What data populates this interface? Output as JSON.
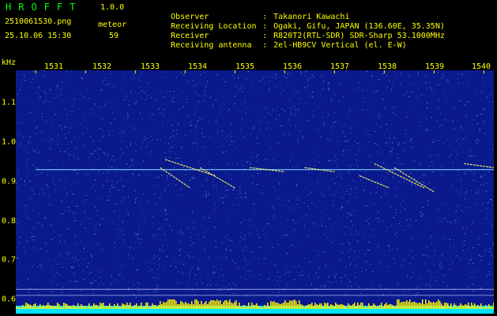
{
  "header": {
    "app_title": "HROFFT",
    "app_version": "1.0.0",
    "file_name": "2510061530.png",
    "date_time": "25.10.06 15:30",
    "meteor_label": "meteor",
    "meteor_count": "59"
  },
  "info": [
    {
      "key": "Observer",
      "value": "Takanori Kawachi"
    },
    {
      "key": "Receiving Location",
      "value": "Ogaki, Gifu, JAPAN (136.60E, 35.35N)"
    },
    {
      "key": "Receiver",
      "value": "R820T2(RTL-SDR) SDR-Sharp 53.1000MHz"
    },
    {
      "key": "Receiving antenna",
      "value": "2el-HB9CV Vertical (el. E-W)"
    }
  ],
  "axis": {
    "unit": "kHz",
    "x_ticks": [
      "1531",
      "1532",
      "1533",
      "1534",
      "1535",
      "1536",
      "1537",
      "1538",
      "1539",
      "1540"
    ],
    "y_ticks": [
      "1.1",
      "1.0",
      "0.9",
      "0.8",
      "0.7",
      "0.6"
    ]
  },
  "colors": {
    "background": "#000000",
    "plot_background": "#0a1a8c",
    "text": "#ffff00",
    "title": "#00ff00",
    "bottom_band": "#00e5ff",
    "signal": "#ffff66"
  },
  "chart_data": {
    "type": "heatmap",
    "xlabel": "",
    "ylabel": "kHz",
    "x_range": [
      1530.6,
      1540.2
    ],
    "y_range": [
      0.56,
      1.16
    ],
    "carrier_line": {
      "y": 0.915,
      "x_start": 1531.0,
      "x_end": 1540.2
    },
    "reference_lines": [
      0.62,
      0.605
    ],
    "meteor_traces": [
      {
        "x1": 1533.6,
        "y1": 0.94,
        "x2": 1534.6,
        "y2": 0.9
      },
      {
        "x1": 1533.5,
        "y1": 0.92,
        "x2": 1534.1,
        "y2": 0.87
      },
      {
        "x1": 1534.3,
        "y1": 0.92,
        "x2": 1535.0,
        "y2": 0.87
      },
      {
        "x1": 1535.3,
        "y1": 0.92,
        "x2": 1536.0,
        "y2": 0.91
      },
      {
        "x1": 1536.4,
        "y1": 0.92,
        "x2": 1537.0,
        "y2": 0.91
      },
      {
        "x1": 1537.8,
        "y1": 0.93,
        "x2": 1538.8,
        "y2": 0.87
      },
      {
        "x1": 1537.5,
        "y1": 0.9,
        "x2": 1538.1,
        "y2": 0.87
      },
      {
        "x1": 1538.2,
        "y1": 0.92,
        "x2": 1539.0,
        "y2": 0.86
      },
      {
        "x1": 1539.6,
        "y1": 0.93,
        "x2": 1540.2,
        "y2": 0.92
      }
    ]
  }
}
